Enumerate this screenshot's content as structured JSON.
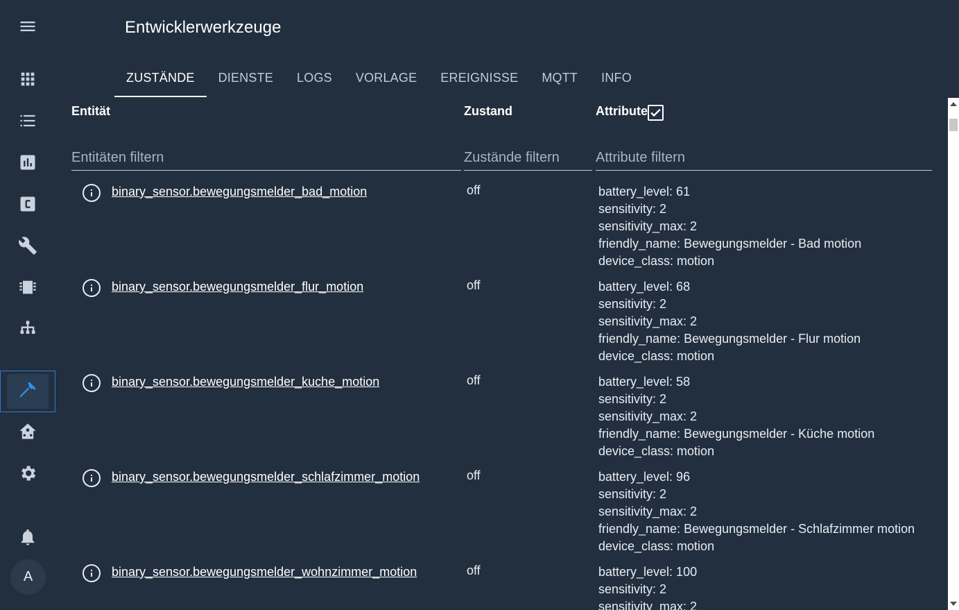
{
  "header": {
    "title": "Entwicklerwerkzeuge"
  },
  "tabs": [
    {
      "label": "ZUSTÄNDE",
      "active": true
    },
    {
      "label": "DIENSTE"
    },
    {
      "label": "LOGS"
    },
    {
      "label": "VORLAGE"
    },
    {
      "label": "EREIGNISSE"
    },
    {
      "label": "MQTT"
    },
    {
      "label": "INFO"
    }
  ],
  "sidebar": {
    "items": [
      {
        "icon": "menu-icon"
      },
      {
        "icon": "apps-icon"
      },
      {
        "icon": "list-icon"
      },
      {
        "icon": "chart-icon"
      },
      {
        "icon": "code-c-icon"
      },
      {
        "icon": "wrench-icon"
      },
      {
        "icon": "chip-icon"
      },
      {
        "icon": "network-icon"
      },
      {
        "icon": "hammer-icon",
        "active": true
      },
      {
        "icon": "home-assistant-icon"
      },
      {
        "icon": "gear-icon"
      },
      {
        "icon": "bell-icon"
      }
    ],
    "avatar": "A",
    "accent_color": "#2f8fe9"
  },
  "table": {
    "headers": {
      "entity": "Entität",
      "state": "Zustand",
      "attributes": "Attribute"
    },
    "attributes_checked": true,
    "filters": {
      "entity_placeholder": "Entitäten filtern",
      "state_placeholder": "Zustände filtern",
      "attributes_placeholder": "Attribute filtern"
    },
    "rows": [
      {
        "entity": "binary_sensor.bewegungsmelder_bad_motion",
        "state": "off",
        "attributes": [
          "battery_level: 61",
          "sensitivity: 2",
          "sensitivity_max: 2",
          "friendly_name: Bewegungsmelder - Bad motion",
          "device_class: motion"
        ]
      },
      {
        "entity": "binary_sensor.bewegungsmelder_flur_motion",
        "state": "off",
        "attributes": [
          "battery_level: 68",
          "sensitivity: 2",
          "sensitivity_max: 2",
          "friendly_name: Bewegungsmelder - Flur motion",
          "device_class: motion"
        ]
      },
      {
        "entity": "binary_sensor.bewegungsmelder_kuche_motion",
        "state": "off",
        "attributes": [
          "battery_level: 58",
          "sensitivity: 2",
          "sensitivity_max: 2",
          "friendly_name: Bewegungsmelder - Küche motion",
          "device_class: motion"
        ]
      },
      {
        "entity": "binary_sensor.bewegungsmelder_schlafzimmer_motion",
        "state": "off",
        "attributes": [
          "battery_level: 96",
          "sensitivity: 2",
          "sensitivity_max: 2",
          "friendly_name: Bewegungsmelder - Schlafzimmer motion",
          "device_class: motion"
        ]
      },
      {
        "entity": "binary_sensor.bewegungsmelder_wohnzimmer_motion",
        "state": "off",
        "attributes": [
          "battery_level: 100",
          "sensitivity: 2",
          "sensitivity_max: 2"
        ]
      }
    ]
  }
}
